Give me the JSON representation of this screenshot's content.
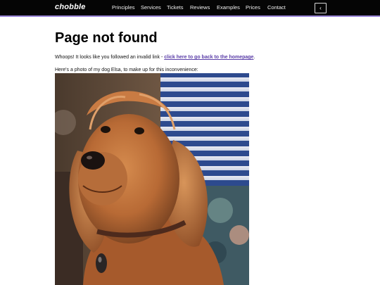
{
  "site": {
    "logo": "chobble"
  },
  "nav": {
    "items": [
      {
        "label": "Principles"
      },
      {
        "label": "Services"
      },
      {
        "label": "Tickets"
      },
      {
        "label": "Reviews"
      },
      {
        "label": "Examples"
      },
      {
        "label": "Prices"
      },
      {
        "label": "Contact"
      }
    ],
    "menu_icon": "chevron-left-icon"
  },
  "main": {
    "title": "Page not found",
    "message_prefix": "Whoops! It looks like you followed an invalid link - ",
    "message_link": "click here to go back to the homepage",
    "message_suffix": ".",
    "photo_caption": "Here's a photo of my dog Elsa, to make up for this inconvenience:"
  },
  "colors": {
    "topbar_bg": "#050505",
    "topbar_border": "#9b87d9",
    "link": "#5b3ea8"
  }
}
